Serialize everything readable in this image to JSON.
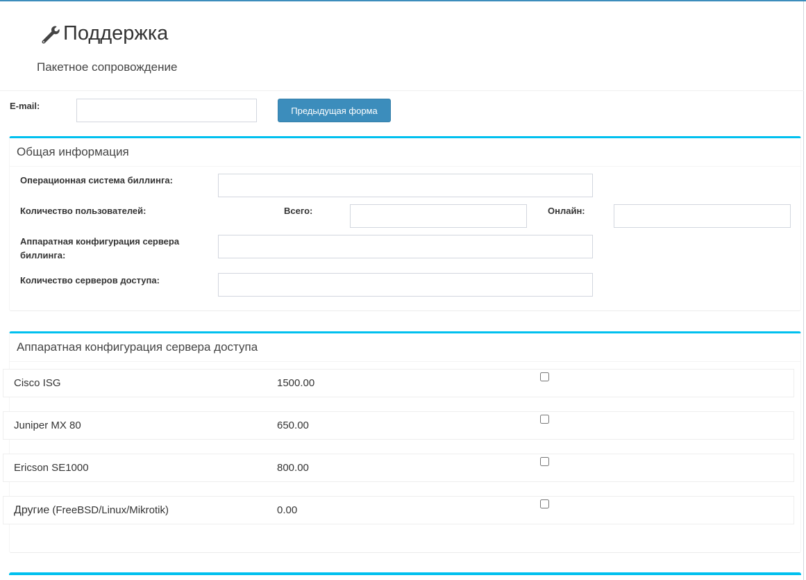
{
  "header": {
    "title": "Поддержка",
    "subtitle": "Пакетное сопровождение"
  },
  "email": {
    "label": "E-mail:",
    "value": "",
    "prev_button": "Предыдущая форма"
  },
  "general": {
    "title": "Общая информация",
    "os_label": "Операционная система биллинга:",
    "users_label": "Количество пользователей:",
    "total_label": "Всего:",
    "online_label": "Онлайн:",
    "hw_label_line1": "Аппаратная конфигурация сервера",
    "hw_label_line2": "биллинга:",
    "servers_label": "Количество серверов доступа:"
  },
  "access": {
    "title": "Аппаратная конфигурация сервера доступа",
    "items": [
      {
        "name": "Cisco ISG",
        "name_prefix": "",
        "price": "1500.00",
        "checked": false
      },
      {
        "name": "Juniper MX 80",
        "name_prefix": "",
        "price": "650.00",
        "checked": false
      },
      {
        "name": "Ericson SE1000",
        "name_prefix": "",
        "price": "800.00",
        "checked": false
      },
      {
        "name": " (FreeBSD/Linux/Mikrotik)",
        "name_prefix": "Другие",
        "price": "0.00",
        "checked": false
      }
    ]
  },
  "colors": {
    "accent": "#3c8dbc",
    "box_border": "#00c0ef"
  },
  "icons": {
    "title_icon": "wrench-icon"
  }
}
